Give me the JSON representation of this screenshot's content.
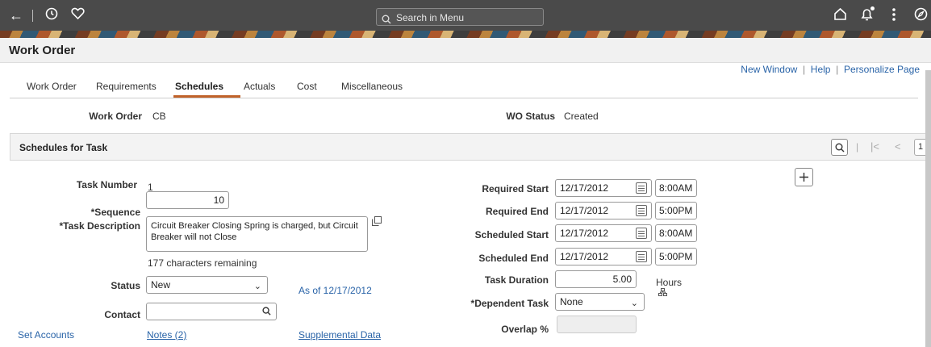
{
  "topbar": {
    "back_icon": "arrow-left",
    "history_icon": "clock",
    "favorites_icon": "heart",
    "search_placeholder": "Search in Menu",
    "home_icon": "home",
    "notifications_icon": "bell",
    "actions_icon": "kebab",
    "navbar_icon": "compass"
  },
  "page": {
    "title": "Work Order"
  },
  "links": {
    "new_window": "New Window",
    "help": "Help",
    "personalize": "Personalize Page"
  },
  "tabs": [
    {
      "label": "Work Order"
    },
    {
      "label": "Requirements"
    },
    {
      "label": "Schedules",
      "active": true
    },
    {
      "label": "Actuals"
    },
    {
      "label": "Cost"
    },
    {
      "label": "Miscellaneous"
    }
  ],
  "header_fields": {
    "work_order_label": "Work Order",
    "work_order_value": "CB",
    "wo_status_label": "WO Status",
    "wo_status_value": "Created"
  },
  "panel": {
    "title": "Schedules for Task",
    "page_num": "1"
  },
  "left": {
    "task_number_label": "Task Number",
    "task_number_value": "1",
    "sequence_label": "*Sequence",
    "sequence_value": "10",
    "task_desc_label": "*Task Description",
    "task_desc_value": "Circuit Breaker Closing Spring is charged, but Circuit Breaker will not Close",
    "chars_remaining": "177 characters remaining",
    "status_label": "Status",
    "status_value": "New",
    "as_of": "As of 12/17/2012",
    "contact_label": "Contact",
    "contact_value": "",
    "set_accounts": "Set Accounts",
    "notes": "Notes (2)",
    "supplemental": "Supplemental Data"
  },
  "right": {
    "required_start_label": "Required Start",
    "required_start_date": "12/17/2012",
    "required_start_time": "8:00AM",
    "required_end_label": "Required End",
    "required_end_date": "12/17/2012",
    "required_end_time": "5:00PM",
    "scheduled_start_label": "Scheduled Start",
    "scheduled_start_date": "12/17/2012",
    "scheduled_start_time": "8:00AM",
    "scheduled_end_label": "Scheduled End",
    "scheduled_end_date": "12/17/2012",
    "scheduled_end_time": "5:00PM",
    "task_duration_label": "Task Duration",
    "task_duration_value": "5.00",
    "hours": "Hours",
    "dependent_task_label": "*Dependent Task",
    "dependent_task_value": "None",
    "overlap_label": "Overlap %",
    "overlap_value": ""
  }
}
